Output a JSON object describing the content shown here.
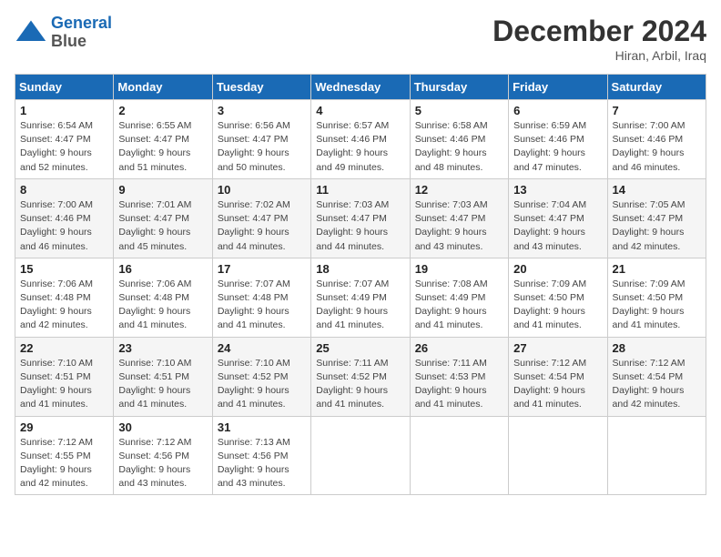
{
  "logo": {
    "line1": "General",
    "line2": "Blue"
  },
  "header": {
    "month": "December 2024",
    "location": "Hiran, Arbil, Iraq"
  },
  "weekdays": [
    "Sunday",
    "Monday",
    "Tuesday",
    "Wednesday",
    "Thursday",
    "Friday",
    "Saturday"
  ],
  "weeks": [
    [
      {
        "day": "1",
        "sunrise": "6:54 AM",
        "sunset": "4:47 PM",
        "daylight": "9 hours and 52 minutes."
      },
      {
        "day": "2",
        "sunrise": "6:55 AM",
        "sunset": "4:47 PM",
        "daylight": "9 hours and 51 minutes."
      },
      {
        "day": "3",
        "sunrise": "6:56 AM",
        "sunset": "4:47 PM",
        "daylight": "9 hours and 50 minutes."
      },
      {
        "day": "4",
        "sunrise": "6:57 AM",
        "sunset": "4:46 PM",
        "daylight": "9 hours and 49 minutes."
      },
      {
        "day": "5",
        "sunrise": "6:58 AM",
        "sunset": "4:46 PM",
        "daylight": "9 hours and 48 minutes."
      },
      {
        "day": "6",
        "sunrise": "6:59 AM",
        "sunset": "4:46 PM",
        "daylight": "9 hours and 47 minutes."
      },
      {
        "day": "7",
        "sunrise": "7:00 AM",
        "sunset": "4:46 PM",
        "daylight": "9 hours and 46 minutes."
      }
    ],
    [
      {
        "day": "8",
        "sunrise": "7:00 AM",
        "sunset": "4:46 PM",
        "daylight": "9 hours and 46 minutes."
      },
      {
        "day": "9",
        "sunrise": "7:01 AM",
        "sunset": "4:47 PM",
        "daylight": "9 hours and 45 minutes."
      },
      {
        "day": "10",
        "sunrise": "7:02 AM",
        "sunset": "4:47 PM",
        "daylight": "9 hours and 44 minutes."
      },
      {
        "day": "11",
        "sunrise": "7:03 AM",
        "sunset": "4:47 PM",
        "daylight": "9 hours and 44 minutes."
      },
      {
        "day": "12",
        "sunrise": "7:03 AM",
        "sunset": "4:47 PM",
        "daylight": "9 hours and 43 minutes."
      },
      {
        "day": "13",
        "sunrise": "7:04 AM",
        "sunset": "4:47 PM",
        "daylight": "9 hours and 43 minutes."
      },
      {
        "day": "14",
        "sunrise": "7:05 AM",
        "sunset": "4:47 PM",
        "daylight": "9 hours and 42 minutes."
      }
    ],
    [
      {
        "day": "15",
        "sunrise": "7:06 AM",
        "sunset": "4:48 PM",
        "daylight": "9 hours and 42 minutes."
      },
      {
        "day": "16",
        "sunrise": "7:06 AM",
        "sunset": "4:48 PM",
        "daylight": "9 hours and 41 minutes."
      },
      {
        "day": "17",
        "sunrise": "7:07 AM",
        "sunset": "4:48 PM",
        "daylight": "9 hours and 41 minutes."
      },
      {
        "day": "18",
        "sunrise": "7:07 AM",
        "sunset": "4:49 PM",
        "daylight": "9 hours and 41 minutes."
      },
      {
        "day": "19",
        "sunrise": "7:08 AM",
        "sunset": "4:49 PM",
        "daylight": "9 hours and 41 minutes."
      },
      {
        "day": "20",
        "sunrise": "7:09 AM",
        "sunset": "4:50 PM",
        "daylight": "9 hours and 41 minutes."
      },
      {
        "day": "21",
        "sunrise": "7:09 AM",
        "sunset": "4:50 PM",
        "daylight": "9 hours and 41 minutes."
      }
    ],
    [
      {
        "day": "22",
        "sunrise": "7:10 AM",
        "sunset": "4:51 PM",
        "daylight": "9 hours and 41 minutes."
      },
      {
        "day": "23",
        "sunrise": "7:10 AM",
        "sunset": "4:51 PM",
        "daylight": "9 hours and 41 minutes."
      },
      {
        "day": "24",
        "sunrise": "7:10 AM",
        "sunset": "4:52 PM",
        "daylight": "9 hours and 41 minutes."
      },
      {
        "day": "25",
        "sunrise": "7:11 AM",
        "sunset": "4:52 PM",
        "daylight": "9 hours and 41 minutes."
      },
      {
        "day": "26",
        "sunrise": "7:11 AM",
        "sunset": "4:53 PM",
        "daylight": "9 hours and 41 minutes."
      },
      {
        "day": "27",
        "sunrise": "7:12 AM",
        "sunset": "4:54 PM",
        "daylight": "9 hours and 41 minutes."
      },
      {
        "day": "28",
        "sunrise": "7:12 AM",
        "sunset": "4:54 PM",
        "daylight": "9 hours and 42 minutes."
      }
    ],
    [
      {
        "day": "29",
        "sunrise": "7:12 AM",
        "sunset": "4:55 PM",
        "daylight": "9 hours and 42 minutes."
      },
      {
        "day": "30",
        "sunrise": "7:12 AM",
        "sunset": "4:56 PM",
        "daylight": "9 hours and 43 minutes."
      },
      {
        "day": "31",
        "sunrise": "7:13 AM",
        "sunset": "4:56 PM",
        "daylight": "9 hours and 43 minutes."
      },
      null,
      null,
      null,
      null
    ]
  ]
}
